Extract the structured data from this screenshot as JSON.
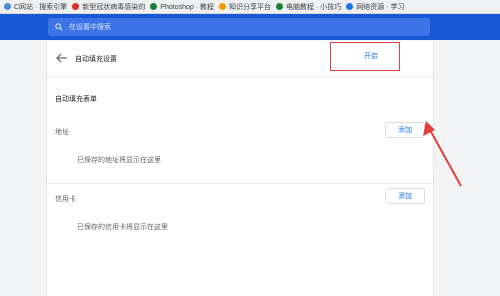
{
  "bookmarks": [
    {
      "label": "C网站 · 搜索引擎",
      "color": "#4a8bd6"
    },
    {
      "label": "新型冠状病毒感染的",
      "color": "#d93025"
    },
    {
      "label": "Photoshop · 教程",
      "color": "#188038"
    },
    {
      "label": "知识分享平台",
      "color": "#f29900"
    },
    {
      "label": "电脑教程 · 小技巧",
      "color": "#188038"
    },
    {
      "label": "网络资源 · 学习",
      "color": "#1a73e8"
    }
  ],
  "search": {
    "placeholder": "在设置中搜索"
  },
  "page": {
    "title": "自动填充设置"
  },
  "autofill": {
    "label": "自动填充表单",
    "toggle_text": "开启"
  },
  "address": {
    "label": "地址",
    "add_label": "添加",
    "empty_text": "已保存的地址将显示在这里"
  },
  "card": {
    "label": "信用卡",
    "add_label": "添加",
    "empty_text": "已保存的信用卡将显示在这里"
  },
  "colors": {
    "header": "#1a57d6",
    "accent": "#1a73e8",
    "annotation": "#e04040"
  }
}
